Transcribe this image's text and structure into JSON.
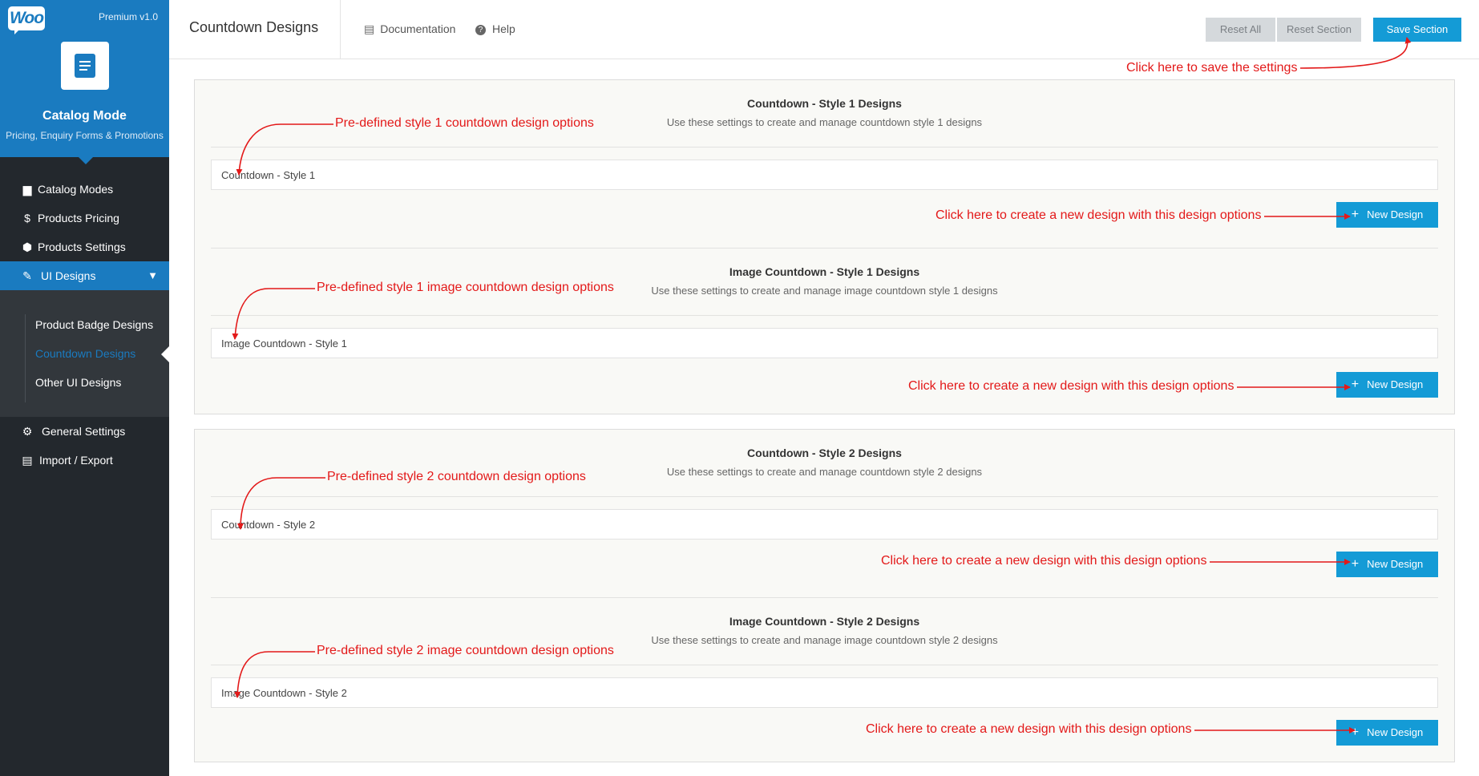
{
  "sidebar": {
    "logo": "Woo",
    "version": "Premium v1.0",
    "title": "Catalog Mode",
    "subtitle": "Pricing, Enquiry Forms & Promotions",
    "items": [
      {
        "label": "Catalog Modes",
        "icon": "book-icon"
      },
      {
        "label": "Products Pricing",
        "icon": "dollar-icon"
      },
      {
        "label": "Products Settings",
        "icon": "cube-icon"
      },
      {
        "label": "UI Designs",
        "icon": "brush-icon"
      }
    ],
    "subitems": [
      {
        "label": "Product Badge Designs"
      },
      {
        "label": "Countdown Designs"
      },
      {
        "label": "Other UI Designs"
      }
    ],
    "bottom_items": [
      {
        "label": "General Settings",
        "icon": "gears-icon"
      },
      {
        "label": "Import / Export",
        "icon": "window-icon"
      }
    ]
  },
  "header": {
    "title": "Countdown Designs",
    "documentation": "Documentation",
    "help": "Help",
    "reset_all": "Reset All",
    "reset_section": "Reset Section",
    "save_section": "Save Section"
  },
  "sections": [
    {
      "groups": [
        {
          "title": "Countdown - Style 1 Designs",
          "desc": "Use these settings to create and manage countdown style 1 designs",
          "field": "Countdown - Style 1",
          "button": "New Design"
        },
        {
          "title": "Image Countdown - Style 1 Designs",
          "desc": "Use these settings to create and manage image countdown style 1 designs",
          "field": "Image Countdown - Style 1",
          "button": "New Design"
        }
      ]
    },
    {
      "groups": [
        {
          "title": "Countdown - Style 2 Designs",
          "desc": "Use these settings to create and manage countdown style 2 designs",
          "field": "Countdown - Style 2",
          "button": "New Design"
        },
        {
          "title": "Image Countdown - Style 2 Designs",
          "desc": "Use these settings to create and manage image countdown style 2 designs",
          "field": "Image Countdown - Style 2",
          "button": "New Design"
        }
      ]
    }
  ],
  "annotations": {
    "save": "Click here to save the settings",
    "predefined": [
      "Pre-defined style 1 countdown design options",
      "Pre-defined style 1 image countdown design options",
      "Pre-defined style 2 countdown design options",
      "Pre-defined style 2 image countdown design options"
    ],
    "create": "Click here to create a new design with this design options"
  },
  "colors": {
    "accent": "#1a7bc0",
    "button": "#149bd6",
    "annotation": "#e31919",
    "sidebar": "#23282d"
  }
}
